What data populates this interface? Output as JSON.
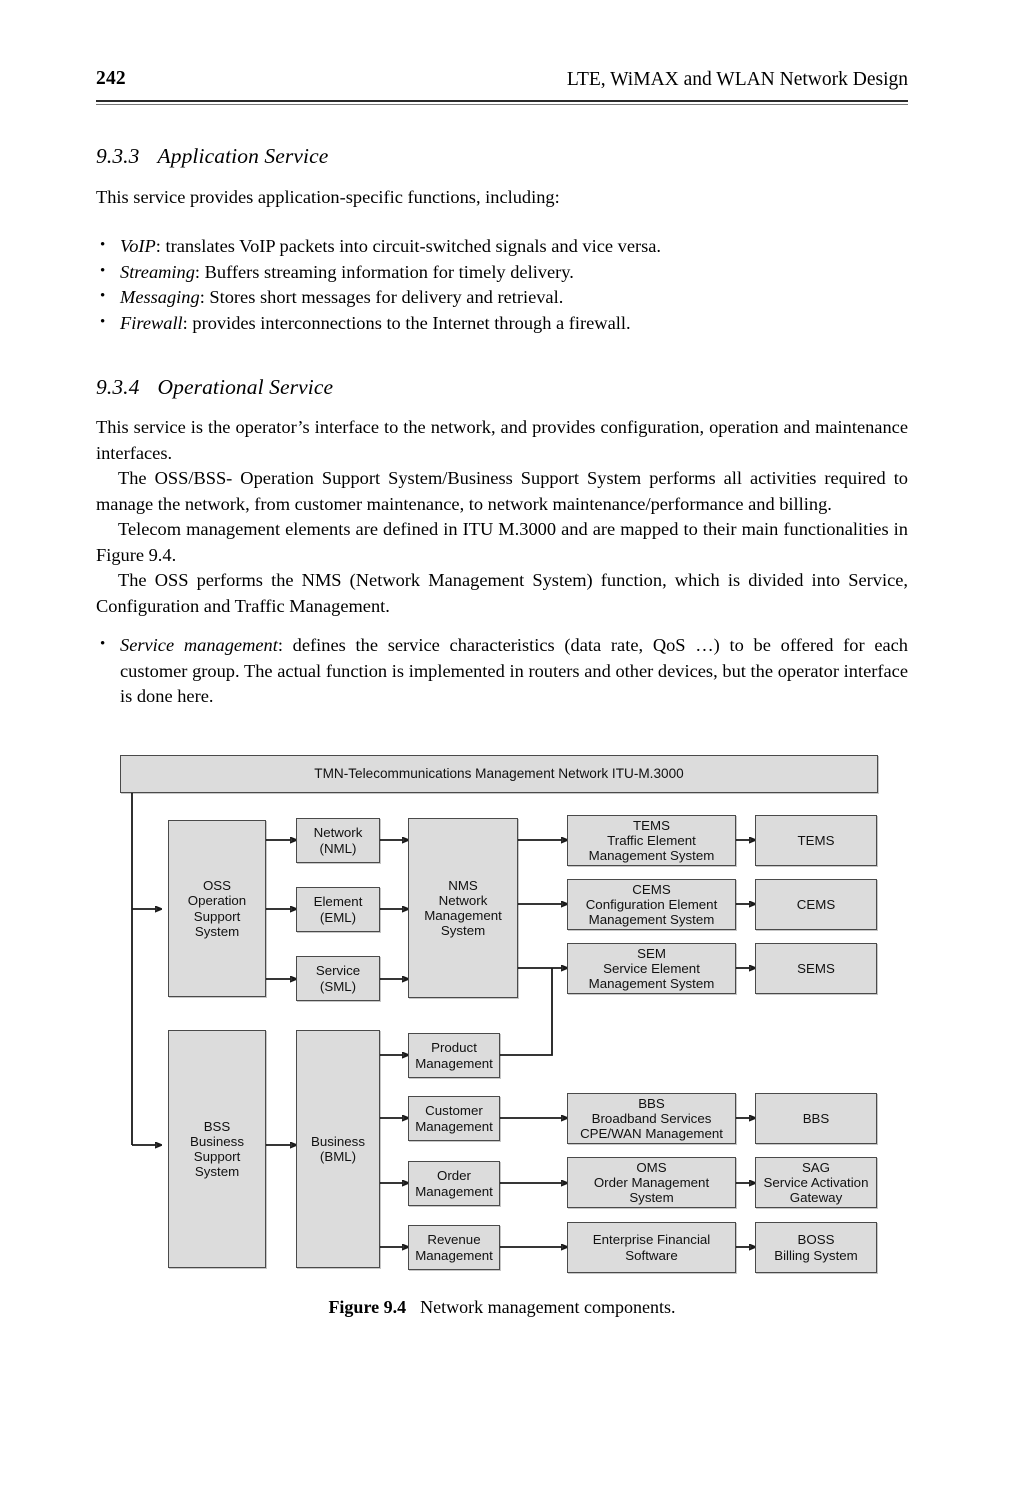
{
  "header": {
    "page_number": "242",
    "book_title": "LTE, WiMAX and WLAN Network Design"
  },
  "sections": {
    "s933": {
      "number": "9.3.3",
      "title": "Application Service",
      "intro": "This service provides application-specific functions, including:",
      "bullets": [
        {
          "term": "VoIP",
          "rest": ": translates VoIP packets into circuit-switched signals and vice versa."
        },
        {
          "term": "Streaming",
          "rest": ": Buffers streaming information for timely delivery."
        },
        {
          "term": "Messaging",
          "rest": ": Stores short messages for delivery and retrieval."
        },
        {
          "term": "Firewall",
          "rest": ": provides interconnections to the Internet through a firewall."
        }
      ]
    },
    "s934": {
      "number": "9.3.4",
      "title": "Operational Service",
      "p1": "This service is the operator’s interface to the network, and provides configuration, operation and maintenance interfaces.",
      "p2": "The OSS/BSS- Operation Support System/Business Support System performs all activities required to manage the network, from customer maintenance, to network maintenance/performance and billing.",
      "p3": "Telecom management elements are defined in ITU M.3000 and are mapped to their main functionalities in Figure 9.4.",
      "p4": "The OSS performs the NMS (Network Management System) function, which is divided into Service, Configuration and Traffic Management.",
      "bullets": [
        {
          "term": "Service management",
          "rest": ": defines the service characteristics (data rate, QoS …) to be offered for each customer group. The actual function is implemented in routers and other devices, but the operator interface is done here."
        }
      ]
    }
  },
  "figure": {
    "caption_label": "Figure 9.4",
    "caption_text": "Network management components.",
    "box_fill": "#dcdcdc",
    "box_stroke": "#4a4a4a",
    "boxes": {
      "tmn": "TMN-Telecommunications Management Network ITU-M.3000",
      "oss": "OSS\nOperation\nSupport\nSystem",
      "network_nml": "Network\n(NML)",
      "element_eml": "Element\n(EML)",
      "service_sml": "Service\n(SML)",
      "nms": "NMS\nNetwork\nManagement\nSystem",
      "tems_full": "TEMS\nTraffic Element\nManagement System",
      "tems": "TEMS",
      "cems_full": "CEMS\nConfiguration Element\nManagement System",
      "cems": "CEMS",
      "sem_full": "SEM\nService Element\nManagement System",
      "sems": "SEMS",
      "bss": "BSS\nBusiness\nSupport\nSystem",
      "business_bml": "Business\n(BML)",
      "product_management": "Product\nManagement",
      "customer_management": "Customer\nManagement",
      "order_management": "Order\nManagement",
      "revenue_management": "Revenue\nManagement",
      "bbs_full": "BBS\nBroadband Services\nCPE/WAN Management",
      "bbs": "BBS",
      "oms_full": "OMS\nOrder Management\nSystem",
      "sag": "SAG\nService Activation\nGateway",
      "enterprise_financial": "Enterprise Financial\nSoftware",
      "boss": "BOSS\nBilling System"
    }
  }
}
